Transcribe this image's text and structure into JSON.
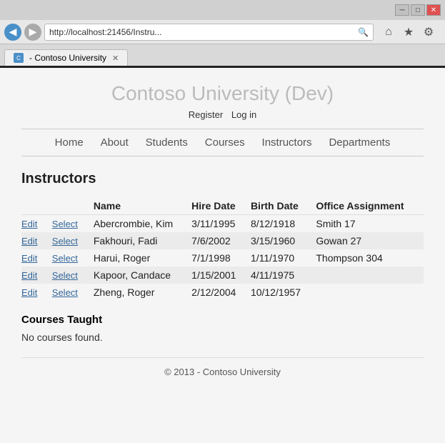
{
  "browser": {
    "title_bar": {
      "minimize": "─",
      "maximize": "□",
      "close": "✕"
    },
    "address": "http://localhost:21456/Instru...",
    "tab_title": "- Contoso University",
    "back_arrow": "◀",
    "forward_arrow": "▶",
    "reload": "↻",
    "home_icon": "⌂",
    "star_icon": "★",
    "gear_icon": "⚙"
  },
  "site": {
    "title": "Contoso University (Dev)",
    "links": [
      {
        "label": "Register"
      },
      {
        "label": "Log in"
      }
    ],
    "nav": [
      {
        "label": "Home"
      },
      {
        "label": "About"
      },
      {
        "label": "Students"
      },
      {
        "label": "Courses"
      },
      {
        "label": "Instructors"
      },
      {
        "label": "Departments"
      }
    ]
  },
  "page": {
    "heading": "Instructors",
    "table": {
      "columns": [
        "Name",
        "Hire Date",
        "Birth Date",
        "Office Assignment"
      ],
      "rows": [
        {
          "name": "Abercrombie, Kim",
          "hire_date": "3/11/1995",
          "birth_date": "8/12/1918",
          "office": "Smith 17"
        },
        {
          "name": "Fakhouri, Fadi",
          "hire_date": "7/6/2002",
          "birth_date": "3/15/1960",
          "office": "Gowan 27"
        },
        {
          "name": "Harui, Roger",
          "hire_date": "7/1/1998",
          "birth_date": "1/11/1970",
          "office": "Thompson 304"
        },
        {
          "name": "Kapoor, Candace",
          "hire_date": "1/15/2001",
          "birth_date": "4/11/1975",
          "office": ""
        },
        {
          "name": "Zheng, Roger",
          "hire_date": "2/12/2004",
          "birth_date": "10/12/1957",
          "office": ""
        }
      ],
      "edit_label": "Edit",
      "select_label": "Select"
    },
    "courses_section": {
      "heading": "Courses Taught",
      "empty_message": "No courses found."
    },
    "footer": "© 2013 - Contoso University"
  }
}
